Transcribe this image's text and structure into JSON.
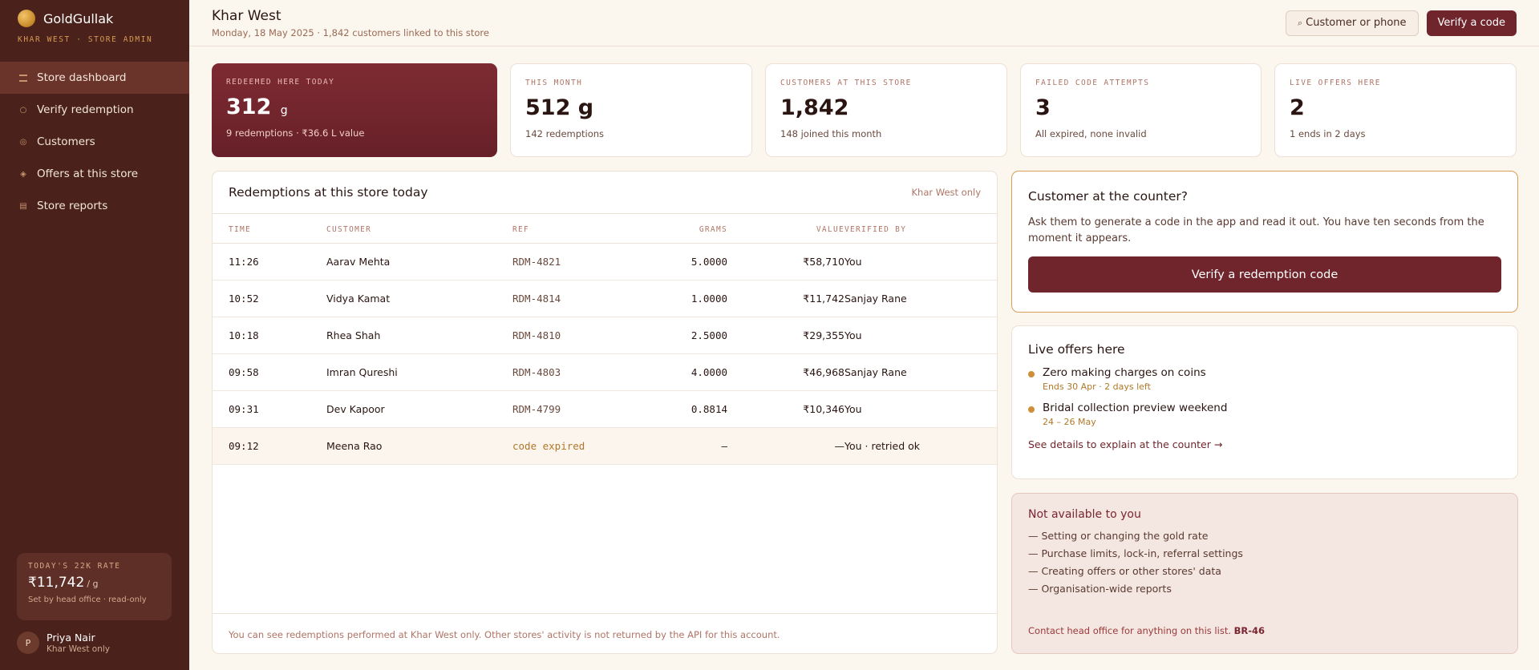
{
  "app": {
    "brand": "GoldGullak",
    "subtitle": "KHAR WEST · STORE ADMIN"
  },
  "sidebar": {
    "items": [
      {
        "label": "Store dashboard",
        "icon": "dashboard-icon",
        "active": true
      },
      {
        "label": "Verify redemption",
        "icon": "circle-icon",
        "active": false
      },
      {
        "label": "Customers",
        "icon": "circle-icon",
        "active": false
      },
      {
        "label": "Offers at this store",
        "icon": "diamond-icon",
        "active": false
      },
      {
        "label": "Store reports",
        "icon": "list-icon",
        "active": false
      }
    ],
    "rate": {
      "label": "TODAY'S 22K RATE",
      "value": "₹11,742",
      "unit": "/ g",
      "note": "Set by head office · read-only"
    },
    "user": {
      "initial": "P",
      "name": "Priya Nair",
      "scope": "Khar West only"
    }
  },
  "header": {
    "title": "Khar West",
    "subtitle": "Monday, 18 May 2025 · 1,842 customers linked to this store",
    "search_label": "Customer or phone",
    "search_icon": "⌕",
    "verify_label": "Verify a code"
  },
  "stats": [
    {
      "label": "REDEEMED HERE TODAY",
      "value": "312",
      "unit": "g",
      "sub": "9 redemptions · ₹36.6 L value"
    },
    {
      "label": "THIS MONTH",
      "value": "512 g",
      "sub": "142 redemptions"
    },
    {
      "label": "CUSTOMERS AT THIS STORE",
      "value": "1,842",
      "sub": "148 joined this month"
    },
    {
      "label": "FAILED CODE ATTEMPTS",
      "value": "3",
      "sub": "All expired, none invalid"
    },
    {
      "label": "LIVE OFFERS HERE",
      "value": "2",
      "sub": "1 ends in 2 days"
    }
  ],
  "redemptions": {
    "title": "Redemptions at this store today",
    "scope": "Khar West only",
    "columns": {
      "time": "TIME",
      "customer": "CUSTOMER",
      "ref": "REF",
      "grams": "GRAMS",
      "value": "VALUE",
      "verified_by": "VERIFIED BY"
    },
    "rows": [
      {
        "time": "11:26",
        "customer": "Aarav Mehta",
        "ref": "RDM-4821",
        "grams": "5.0000",
        "value": "₹58,710",
        "verified_by": "You"
      },
      {
        "time": "10:52",
        "customer": "Vidya Kamat",
        "ref": "RDM-4814",
        "grams": "1.0000",
        "value": "₹11,742",
        "verified_by": "Sanjay Rane"
      },
      {
        "time": "10:18",
        "customer": "Rhea Shah",
        "ref": "RDM-4810",
        "grams": "2.5000",
        "value": "₹29,355",
        "verified_by": "You"
      },
      {
        "time": "09:58",
        "customer": "Imran Qureshi",
        "ref": "RDM-4803",
        "grams": "4.0000",
        "value": "₹46,968",
        "verified_by": "Sanjay Rane"
      },
      {
        "time": "09:31",
        "customer": "Dev Kapoor",
        "ref": "RDM-4799",
        "grams": "0.8814",
        "value": "₹10,346",
        "verified_by": "You"
      },
      {
        "time": "09:12",
        "customer": "Meena Rao",
        "ref": "code expired",
        "grams": "—",
        "value": "—",
        "verified_by": "You · retried ok"
      }
    ],
    "footer": "You can see redemptions performed at Khar West only. Other stores' activity is not returned by the API for this account."
  },
  "counter": {
    "title": "Customer at the counter?",
    "body": "Ask them to generate a code in the app and read it out. You have ten seconds from the moment it appears.",
    "button": "Verify a redemption code"
  },
  "offers": {
    "title": "Live offers here",
    "items": [
      {
        "title": "Zero making charges on coins",
        "meta": "Ends 30 Apr · 2 days left"
      },
      {
        "title": "Bridal collection preview weekend",
        "meta": "24 – 26 May"
      }
    ],
    "link": "See details to explain at the counter →"
  },
  "not_available": {
    "title": "Not available to you",
    "items": [
      "— Setting or changing the gold rate",
      "— Purchase limits, lock-in, referral settings",
      "— Creating offers or other stores' data",
      "— Organisation-wide reports"
    ],
    "footer": "Contact head office for anything on this list.",
    "code": "BR-46"
  },
  "colors": {
    "sidebar": "#4a221b",
    "accent": "#6f252b",
    "gold": "#cf8f3a",
    "background": "#fbf6ee"
  }
}
